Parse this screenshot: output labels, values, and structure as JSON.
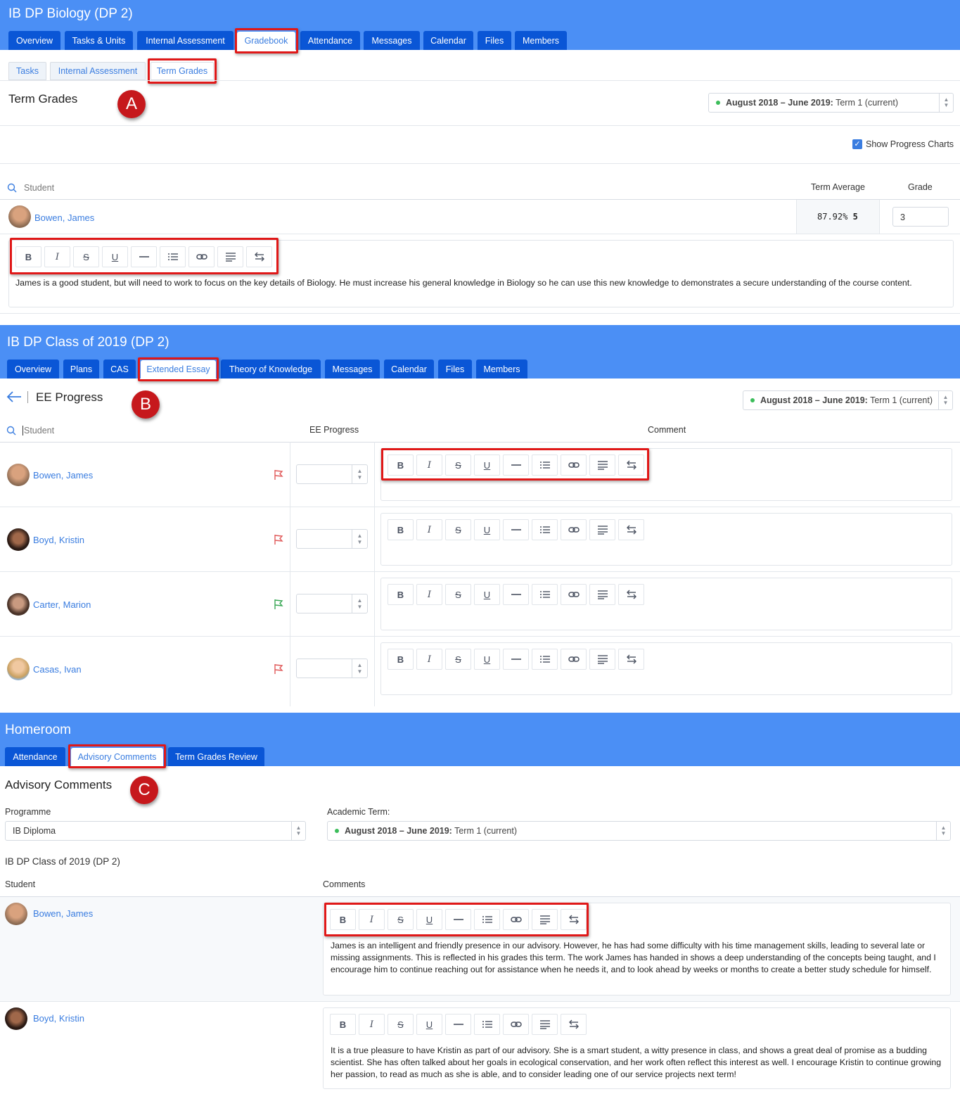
{
  "sectionA": {
    "title": "IB DP Biology (DP 2)",
    "tabs": [
      "Overview",
      "Tasks & Units",
      "Internal Assessment",
      "Gradebook",
      "Attendance",
      "Messages",
      "Calendar",
      "Files",
      "Members"
    ],
    "subtabs": [
      "Tasks",
      "Internal Assessment",
      "Term Grades"
    ],
    "page_title": "Term Grades",
    "badge": "A",
    "term_select": {
      "bold": "August 2018 – June 2019:",
      "rest": " Term 1 (current)"
    },
    "show_progress_label": "Show Progress Charts",
    "col_student": "Student",
    "col_term_average": "Term Average",
    "col_grade": "Grade",
    "student": "Bowen, James",
    "term_average": "87.92%",
    "term_average_grade": "5",
    "grade_value": "3",
    "comment": "James is a good student, but will need to work to focus on the key details of Biology. He must increase his general knowledge in Biology so he can use this new knowledge to demonstrates a secure understanding of the course content."
  },
  "sectionB": {
    "title": "IB DP Class of 2019 (DP 2)",
    "tabs": [
      "Overview",
      "Plans",
      "CAS",
      "Extended Essay",
      "Theory of Knowledge",
      "Messages",
      "Calendar",
      "Files",
      "Members"
    ],
    "page_title": "EE Progress",
    "badge": "B",
    "term_select": {
      "bold": "August 2018 – June 2019:",
      "rest": " Term 1 (current)"
    },
    "col_student": "Student",
    "col_progress": "EE Progress",
    "col_comment": "Comment",
    "students": [
      "Bowen, James",
      "Boyd, Kristin",
      "Carter, Marion",
      "Casas, Ivan"
    ],
    "flag_colors": [
      "#e05a5a",
      "#e05a5a",
      "#3aa856",
      "#e05a5a"
    ]
  },
  "sectionC": {
    "title": "Homeroom",
    "tabs": [
      "Attendance",
      "Advisory Comments",
      "Term Grades Review"
    ],
    "page_title": "Advisory Comments",
    "badge": "C",
    "programme_label": "Programme",
    "programme_value": "IB Diploma",
    "term_label": "Academic Term:",
    "term_select": {
      "bold": "August 2018 – June 2019:",
      "rest": " Term 1 (current)"
    },
    "class_title": "IB DP Class of 2019 (DP 2)",
    "col_student": "Student",
    "col_comments": "Comments",
    "students": [
      "Bowen, James",
      "Boyd, Kristin"
    ],
    "comments": [
      "James is an intelligent and friendly presence in our advisory. However, he has had some difficulty with his time management skills, leading to several late or missing assignments. This is reflected in his grades this term. The work James has handed in shows a deep understanding of the concepts being taught, and I encourage him to continue reaching out for assistance when he needs it, and to look ahead by weeks or months to create a better study schedule for himself.",
      "It is a true pleasure to have Kristin as part of our advisory. She is a smart student, a witty presence in class, and shows a great deal of promise as a budding scientist. She has often talked about her goals in ecological conservation, and her work often reflect this interest as well. I encourage Kristin to continue growing her passion, to read as much as she is able, and to consider leading one of our service projects next term!"
    ]
  },
  "toolbar_buttons": [
    "bold",
    "italic",
    "strikethrough",
    "underline",
    "horizontal-rule",
    "bullet-list",
    "link",
    "align",
    "direction"
  ],
  "colors": {
    "header_blue": "#4b8ff5",
    "tab_blue": "#0a56d6",
    "link_blue": "#3a7de0",
    "highlight_red": "#e01818"
  }
}
